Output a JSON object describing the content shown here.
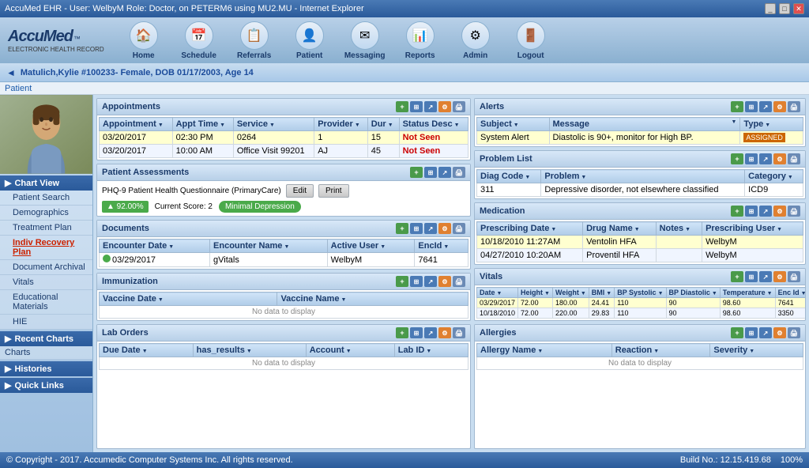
{
  "titlebar": {
    "title": "AccuMed EHR - User: WelbyM Role: Doctor, on PETERM6 using MU2.MU - Internet Explorer",
    "controls": [
      "_",
      "□",
      "✕"
    ]
  },
  "navbar": {
    "logo": "AccuMed",
    "logo_tm": "™",
    "logo_sub": "ELECTRONIC HEALTH RECORD",
    "items": [
      {
        "label": "Home",
        "icon": "🏠"
      },
      {
        "label": "Schedule",
        "icon": "📅"
      },
      {
        "label": "Referrals",
        "icon": "📋"
      },
      {
        "label": "Patient",
        "icon": "👤"
      },
      {
        "label": "Messaging",
        "icon": "✉"
      },
      {
        "label": "Reports",
        "icon": "📊"
      },
      {
        "label": "Admin",
        "icon": "⚙"
      },
      {
        "label": "Logout",
        "icon": "🚪"
      }
    ]
  },
  "patient_bar": {
    "arrow": "◄",
    "name": "Matulich,Kylie #100233- Female, DOB 01/17/2003, Age 14"
  },
  "breadcrumb": {
    "path": "Patient"
  },
  "sidebar": {
    "chart_view_label": "Chart View",
    "items": [
      {
        "label": "Patient Search",
        "active": false
      },
      {
        "label": "Demographics",
        "active": false
      },
      {
        "label": "Treatment Plan",
        "active": false
      },
      {
        "label": "Indiv Recovery Plan",
        "active": true
      },
      {
        "label": "Document Archival",
        "active": false
      },
      {
        "label": "Vitals",
        "active": false
      },
      {
        "label": "Educational Materials",
        "active": false
      },
      {
        "label": "HIE",
        "active": false
      }
    ],
    "recent_charts_label": "Recent Charts",
    "charts_label": "Charts",
    "histories_label": "Histories",
    "quick_links_label": "Quick Links"
  },
  "appointments": {
    "title": "Appointments",
    "columns": [
      "Appointment",
      "Appt Time",
      "Service",
      "Provider",
      "Dur",
      "Status Desc"
    ],
    "rows": [
      {
        "date": "03/20/2017",
        "time": "02:30 PM",
        "service": "0264",
        "provider": "1",
        "dur": "15",
        "status": "Not Seen",
        "highlight": true
      },
      {
        "date": "03/20/2017",
        "time": "10:00 AM",
        "service": "Office Visit 99201",
        "provider": "AJ",
        "dur": "45",
        "status": "Not Seen",
        "highlight": false
      }
    ]
  },
  "assessments": {
    "title": "Patient Assessments",
    "phq_label": "PHQ-9 Patient Health Questionnaire (PrimaryCare)",
    "edit_btn": "Edit",
    "print_btn": "Print",
    "score_pct": "▲ 92.00%",
    "current_score": "Current Score: 2",
    "depression_label": "Minimal Depression"
  },
  "documents": {
    "title": "Documents",
    "columns": [
      "Encounter Date",
      "Encounter Name",
      "Active User",
      "EncId"
    ],
    "rows": [
      {
        "date": "03/29/2017",
        "name": "gVitals",
        "user": "WelbyM",
        "encid": "7641",
        "has_dot": true
      }
    ]
  },
  "immunization": {
    "title": "Immunization",
    "columns": [
      "Vaccine Date",
      "Vaccine Name"
    ],
    "no_data": "No data to display"
  },
  "lab_orders": {
    "title": "Lab Orders",
    "columns": [
      "Due Date",
      "has_results",
      "Account",
      "Lab ID"
    ],
    "no_data": "No data to display"
  },
  "alerts": {
    "title": "Alerts",
    "columns": [
      "Subject",
      "Message",
      "Type"
    ],
    "rows": [
      {
        "subject": "System Alert",
        "message": "Diastolic is 90+, monitor for High BP.",
        "type": "ASSIGNED",
        "highlight": true
      }
    ]
  },
  "problems": {
    "title": "Problem List",
    "columns": [
      "Diag Code",
      "Problem",
      "Category"
    ],
    "rows": [
      {
        "code": "311",
        "problem": "Depressive disorder, not elsewhere classified",
        "category": "ICD9"
      }
    ]
  },
  "medication": {
    "title": "Medication",
    "columns": [
      "Prescribing Date",
      "Drug Name",
      "Notes",
      "Prescribing User"
    ],
    "rows": [
      {
        "date": "10/18/2010 11:27AM",
        "drug": "Ventolin HFA",
        "notes": "",
        "user": "WelbyM",
        "highlight": true
      },
      {
        "date": "04/27/2010 10:20AM",
        "drug": "Proventil HFA",
        "notes": "",
        "user": "WelbyM",
        "highlight": false
      }
    ]
  },
  "vitals": {
    "title": "Vitals",
    "columns": [
      "Date",
      "Height",
      "Weight",
      "BMI",
      "BP Systolic",
      "BP Diastolic",
      "Temperature",
      "Enc Id"
    ],
    "rows": [
      {
        "date": "03/29/2017",
        "height": "72.00",
        "weight": "180.00",
        "bmi": "24.41",
        "bp_sys": "110",
        "bp_dia": "90",
        "temp": "98.60",
        "encid": "7641",
        "highlight": true
      },
      {
        "date": "10/18/2010",
        "height": "72.00",
        "weight": "220.00",
        "bmi": "29.83",
        "bp_sys": "110",
        "bp_dia": "90",
        "temp": "98.60",
        "encid": "3350",
        "highlight": false
      }
    ]
  },
  "allergies": {
    "title": "Allergies",
    "columns": [
      "Allergy Name",
      "Reaction",
      "Severity"
    ],
    "no_data": "No data to display"
  },
  "footer": {
    "copyright": "© Copyright - 2017. Accumedic Computer Systems Inc. All rights reserved.",
    "build": "Build No.: 12.15.419.68",
    "zoom": "100%"
  }
}
